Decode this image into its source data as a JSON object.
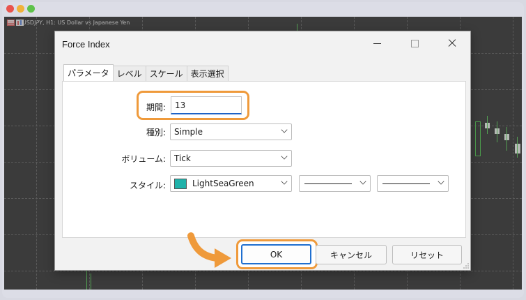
{
  "chart": {
    "title": "USDJPY, H1:  US Dollar vs Japanese Yen"
  },
  "dialog": {
    "title": "Force Index",
    "tabs": [
      {
        "label": "パラメータ",
        "active": true
      },
      {
        "label": "レベル",
        "active": false
      },
      {
        "label": "スケール",
        "active": false
      },
      {
        "label": "表示選択",
        "active": false
      }
    ],
    "fields": {
      "period_label": "期間:",
      "period_value": "13",
      "method_label": "種別:",
      "method_value": "Simple",
      "volume_label": "ボリューム:",
      "volume_value": "Tick",
      "style_label": "スタイル:",
      "style_color_name": "LightSeaGreen",
      "style_color_hex": "#20b2aa"
    },
    "buttons": {
      "ok": "OK",
      "cancel": "キャンセル",
      "reset": "リセット"
    }
  },
  "colors": {
    "highlight": "#ef9a3b",
    "ok_border": "#1f6fd0"
  }
}
